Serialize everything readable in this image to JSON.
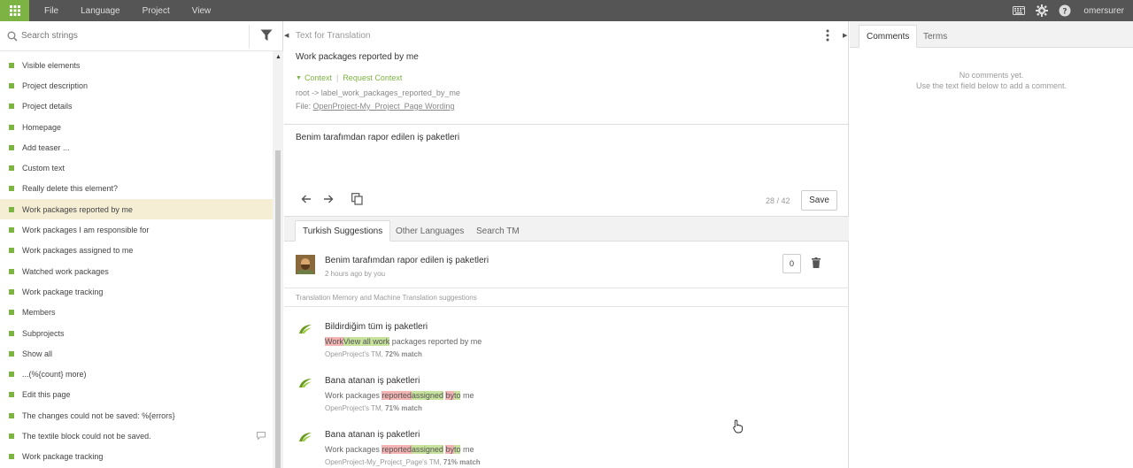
{
  "topbar": {
    "menu": [
      "File",
      "Language",
      "Project",
      "View"
    ],
    "user": "omersurer"
  },
  "sidebar": {
    "search_placeholder": "Search strings",
    "items": [
      {
        "label": "Visible elements"
      },
      {
        "label": "Project description"
      },
      {
        "label": "Project details"
      },
      {
        "label": "Homepage"
      },
      {
        "label": "Add teaser ..."
      },
      {
        "label": "Custom text"
      },
      {
        "label": "Really delete this element?"
      },
      {
        "label": "Work packages reported by me"
      },
      {
        "label": "Work packages I am responsible for"
      },
      {
        "label": "Work packages assigned to me"
      },
      {
        "label": "Watched work packages"
      },
      {
        "label": "Work package tracking"
      },
      {
        "label": "Members"
      },
      {
        "label": "Subprojects"
      },
      {
        "label": "Show all"
      },
      {
        "label": "...(%{count} more)"
      },
      {
        "label": "Edit this page"
      },
      {
        "label": "The changes could not be saved: %{errors}"
      },
      {
        "label": "The textile block could not be saved."
      },
      {
        "label": "Work package tracking"
      }
    ]
  },
  "editor": {
    "header": "Text for Translation",
    "source_text": "Work packages reported by me",
    "context_label": "Context",
    "request_context": "Request Context",
    "key": "root -> label_work_packages_reported_by_me",
    "file_prefix": "File:",
    "file_name": "OpenProject-My_Project_Page Wording",
    "translation": "Benim tarafımdan rapor edilen iş paketleri",
    "counter": "28 / 42",
    "save_label": "Save",
    "tabs": [
      "Turkish Suggestions",
      "Other Languages",
      "Search TM"
    ]
  },
  "suggestion": {
    "text": "Benim tarafımdan rapor edilen iş paketleri",
    "meta": "2 hours ago by you",
    "votes": "0"
  },
  "tm": {
    "heading": "Translation Memory and Machine Translation suggestions",
    "items": [
      {
        "translation": "Bildirdiğim tüm iş paketleri",
        "src_del1": "Work",
        "src_ins1": "View all work",
        "src_rest": " packages reported by me",
        "source": "OpenProject's TM,",
        "match": "72% match"
      },
      {
        "translation": "Bana atanan iş paketleri",
        "src_pre": "Work packages ",
        "src_del1": "reported",
        "src_ins1": "assigned",
        "src_mid": " ",
        "src_del2": "by",
        "src_ins2": "to",
        "src_post": " me",
        "source": "OpenProject's TM,",
        "match": "71% match"
      },
      {
        "translation": "Bana atanan iş paketleri",
        "src_pre": "Work packages ",
        "src_del1": "reported",
        "src_ins1": "assigned",
        "src_mid": " ",
        "src_del2": "by",
        "src_ins2": "to",
        "src_post": " me",
        "source": "OpenProject-My_Project_Page's TM,",
        "match": "71% match"
      }
    ]
  },
  "comments": {
    "tabs": [
      "Comments",
      "Terms"
    ],
    "empty_line1": "No comments yet.",
    "empty_line2": "Use the text field below to add a comment."
  },
  "colors": {
    "accent": "#7cb342",
    "topbar": "#555555",
    "active_row": "#f5eed5",
    "diff_delete": "#f3b3b3",
    "diff_insert": "#c7e29c"
  }
}
